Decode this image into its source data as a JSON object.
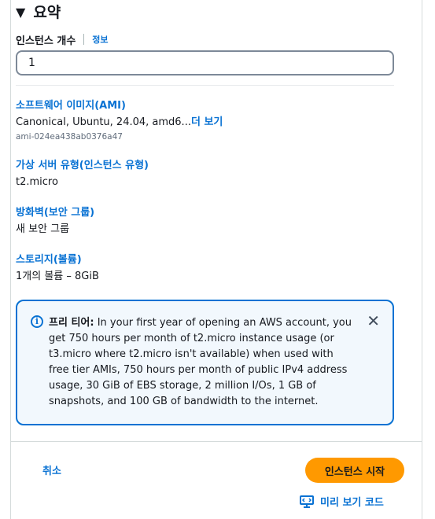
{
  "summary": {
    "title": "요약",
    "instance_count_label": "인스턴스 개수",
    "info_link": "정보",
    "instance_count_value": "1"
  },
  "items": {
    "ami": {
      "title": "소프트웨어 이미지(AMI)",
      "value": "Canonical, Ubuntu, 24.04, amd6...",
      "more_link": "더 보기",
      "sub": "ami-024ea438ab0376a47"
    },
    "instance_type": {
      "title": "가상 서버 유형(인스턴스 유형)",
      "value": "t2.micro"
    },
    "firewall": {
      "title": "방화벽(보안 그룹)",
      "value": "새 보안 그룹"
    },
    "storage": {
      "title": "스토리지(볼륨)",
      "value": "1개의 볼륨 – 8GiB"
    }
  },
  "alert": {
    "label": "프리 티어:",
    "text": "In your first year of opening an AWS account, you get 750 hours per month of t2.micro instance usage (or t3.micro where t2.micro isn't available) when used with free tier AMIs, 750 hours per month of public IPv4 address usage, 30 GiB of EBS storage, 2 million I/Os, 1 GB of snapshots, and 100 GB of bandwidth to the internet."
  },
  "footer": {
    "cancel_label": "취소",
    "launch_label": "인스턴스 시작",
    "preview_label": "미리 보기 코드"
  },
  "colors": {
    "link": "#0972d3",
    "primary_button": "#ff9900",
    "alert_bg": "#f2f8fd",
    "alert_border": "#0972d3"
  },
  "icons": [
    "caret-down-icon",
    "info-icon",
    "close-icon",
    "code-preview-icon"
  ]
}
